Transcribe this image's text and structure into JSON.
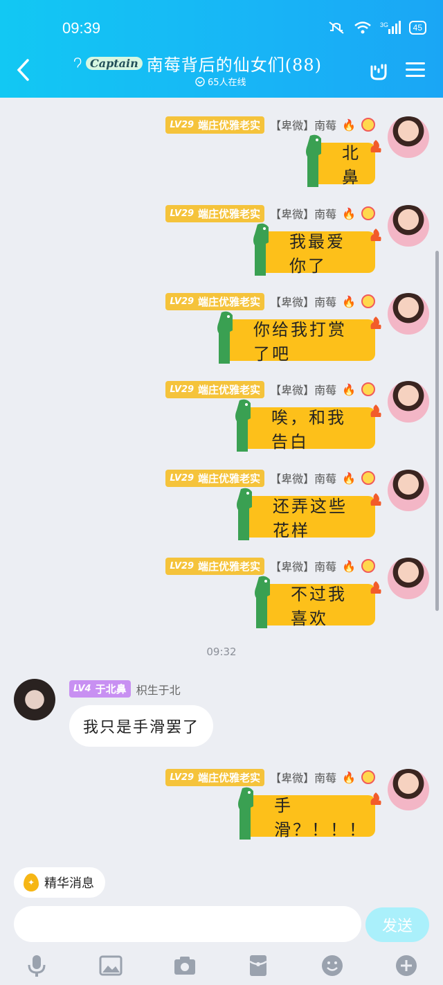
{
  "status": {
    "time": "09:39",
    "battery": "45",
    "network": "3G"
  },
  "header": {
    "title": "南莓背后的仙女们(88)",
    "logo_text": "Captain",
    "online": "65人在线"
  },
  "sender_right": {
    "level": "LV29",
    "title": "端庄优雅老实",
    "tag": "【卑微】南莓"
  },
  "messages_right": [
    {
      "text": "北鼻"
    },
    {
      "text": "我最爱你了"
    },
    {
      "text": "你给我打赏了吧"
    },
    {
      "text": "唉，和我告白"
    },
    {
      "text": "还弄这些花样"
    },
    {
      "text": "不过我喜欢"
    },
    {
      "text": "手滑？！！！"
    }
  ],
  "time_separator": "09:32",
  "message_left": {
    "level": "LV4",
    "title": "于北鼻",
    "name": "枳生于北",
    "text": "我只是手滑罢了"
  },
  "bottom": {
    "featured_label": "精华消息",
    "send_label": "发送"
  },
  "toolbar": [
    "mic-icon",
    "image-icon",
    "camera-icon",
    "red-packet-icon",
    "emoji-icon",
    "plus-icon"
  ]
}
